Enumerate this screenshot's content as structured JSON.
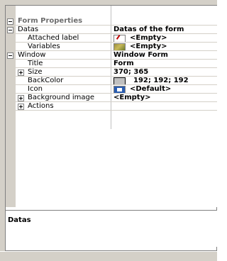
{
  "grid": {
    "title": "Form Properties",
    "rows": [
      {
        "label": "Datas",
        "value": "Datas of the form"
      },
      {
        "label": "Attached label",
        "value": "<Empty>"
      },
      {
        "label": "Variables",
        "value": "<Empty>"
      },
      {
        "label": "Window",
        "value": "Window Form"
      },
      {
        "label": "Title",
        "value": "Form"
      },
      {
        "label": "Size",
        "value": "370; 365"
      },
      {
        "label": "BackColor",
        "value": "192; 192; 192"
      },
      {
        "label": "Icon",
        "value": "<Default>"
      },
      {
        "label": "Background image",
        "value": "<Empty>"
      },
      {
        "label": "Actions",
        "value": ""
      }
    ]
  },
  "description": {
    "title": "Datas"
  },
  "colors": {
    "backcolor_swatch": "#c0c0c0",
    "grid_line": "#d4d0c8"
  }
}
